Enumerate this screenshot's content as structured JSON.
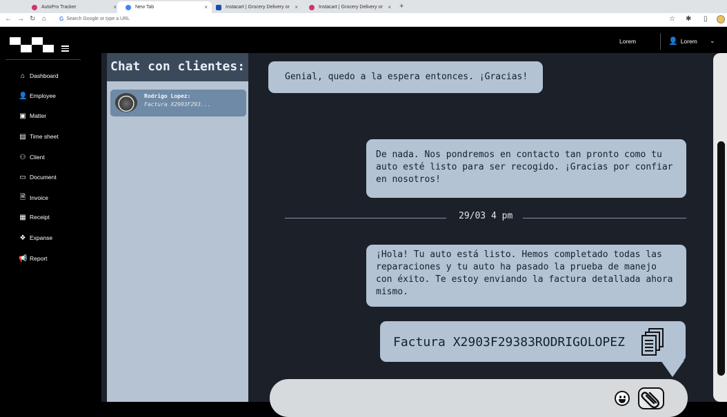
{
  "browser": {
    "tabs": [
      {
        "title": "AutoPro Tracker",
        "color": "#d6336c"
      },
      {
        "title": "New Tab",
        "color": "#4285f4"
      },
      {
        "title": "Instacart | Grocery Delivery or",
        "color": "#1a4ea8"
      },
      {
        "title": "Instacart | Grocery Delivery or",
        "color": "#d6336c"
      }
    ],
    "address": "Search Google or type a URL"
  },
  "header": {
    "user_left": "Lorem",
    "user_right": "Lorem"
  },
  "sidebar": {
    "items": [
      {
        "label": "Dashboard",
        "icon": "home-icon"
      },
      {
        "label": "Employee",
        "icon": "person-icon"
      },
      {
        "label": "Matter",
        "icon": "bookmark-icon"
      },
      {
        "label": "Time sheet",
        "icon": "calendar-icon"
      },
      {
        "label": "Client",
        "icon": "group-icon"
      },
      {
        "label": "Document",
        "icon": "folder-icon"
      },
      {
        "label": "Invoice",
        "icon": "file-icon"
      },
      {
        "label": "Receipt",
        "icon": "receipt-icon"
      },
      {
        "label": "Expanse",
        "icon": "money-icon"
      },
      {
        "label": "Report",
        "icon": "megaphone-icon"
      }
    ]
  },
  "chat_list": {
    "title": "Chat con clientes:",
    "contacts": [
      {
        "name": "Rodrigo Lopez:",
        "preview": "Factura X2903F293..."
      }
    ]
  },
  "conversation": {
    "messages": [
      {
        "text": "Genial, quedo a la espera entonces. ¡Gracias!"
      },
      {
        "text": "De nada. Nos pondremos en contacto tan pronto como tu auto esté listo para ser recogido. ¡Gracias por confiar en nosotros!"
      },
      {
        "text": "¡Hola! Tu auto está listo. Hemos completado todas las reparaciones y tu auto ha pasado la prueba de manejo con éxito. Te estoy enviando la factura detallada ahora mismo."
      }
    ],
    "date_separator": "29/03 4 pm",
    "file_message": "Factura X2903F29383RODRIGOLOPEZ"
  },
  "composer": {
    "placeholder": ""
  }
}
